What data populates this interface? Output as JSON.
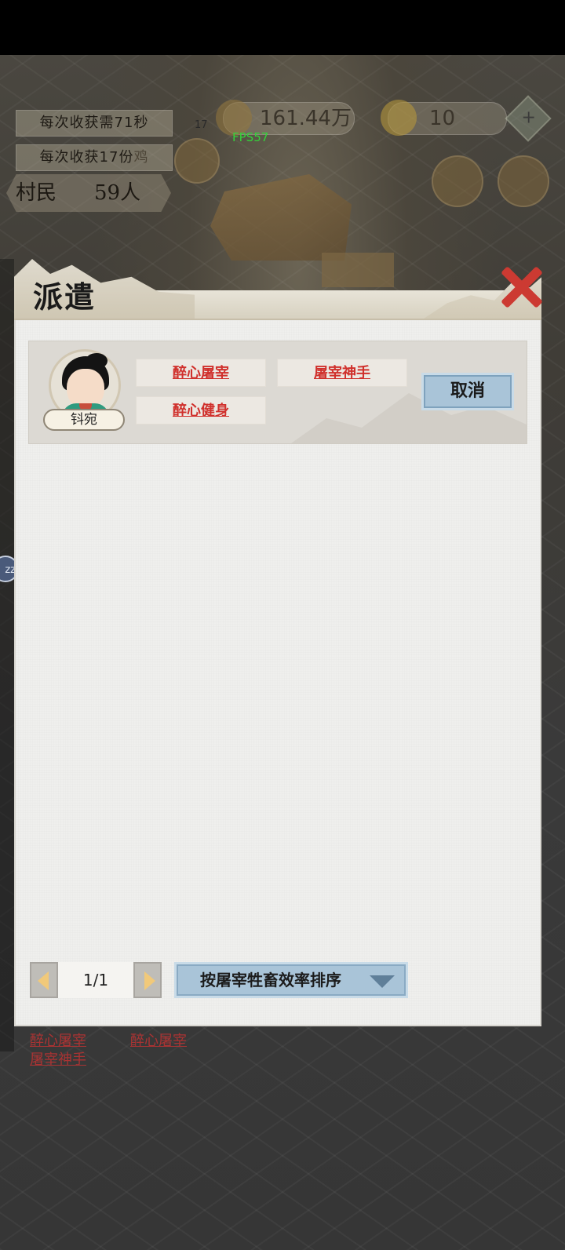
{
  "hud": {
    "harvest_time": "每次收获需71秒",
    "harvest_yield_a": "每次收获17份",
    "harvest_yield_b": "鸡",
    "villager_label": "村民",
    "villager_count": "59人",
    "money": "161.44万",
    "gold": "10",
    "fps": "FPS57",
    "side_num": "17"
  },
  "background_traits": {
    "left_1": "醉心屠宰",
    "left_2": "屠宰神手",
    "right_1": "醉心屠宰"
  },
  "zz_bubble": "zz",
  "dialog": {
    "title": "派遣",
    "close_icon": "close-x-icon",
    "card": {
      "name": "钭宛",
      "traits": [
        "醉心屠宰",
        "屠宰神手",
        "醉心健身"
      ],
      "cancel_label": "取消"
    },
    "pager": {
      "page": "1/1",
      "sort_label": "按屠宰牲畜效率排序"
    }
  },
  "colors": {
    "trait_red": "#d0302c",
    "button_blue": "#a9c4d8",
    "close_red": "#cc3a32",
    "fps_green": "#33d43a"
  }
}
